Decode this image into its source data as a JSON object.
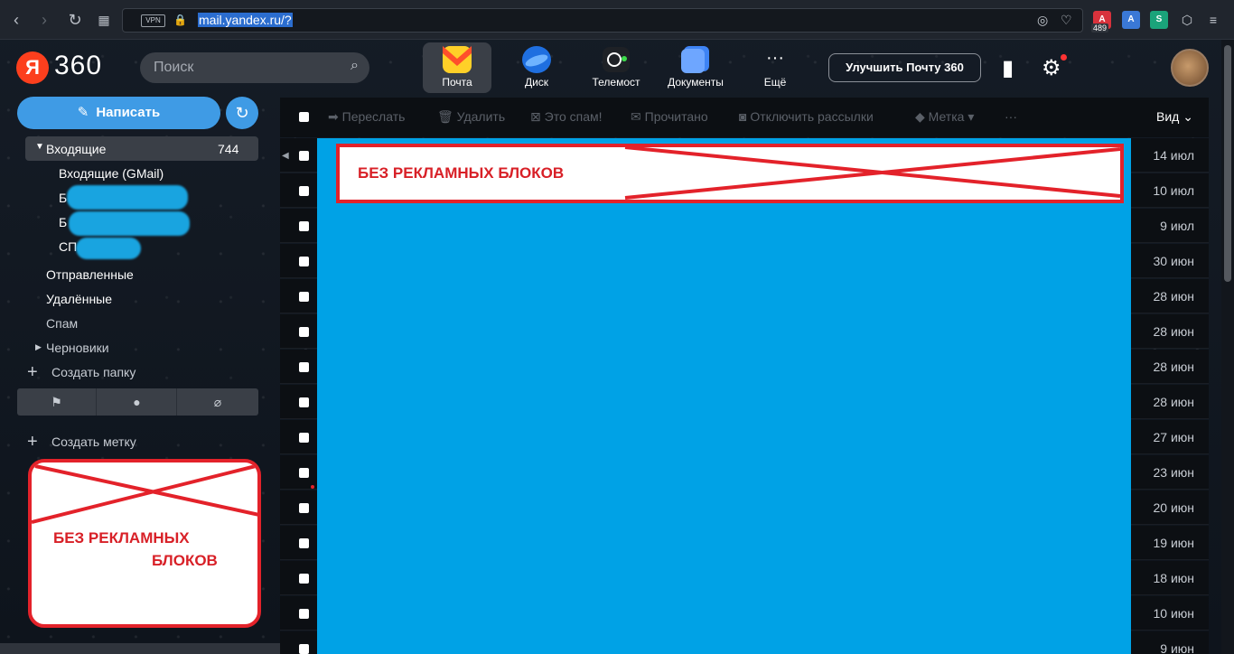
{
  "browser": {
    "url": "mail.yandex.ru/?",
    "vpn_label": "VPN",
    "ext_badge": "489"
  },
  "header": {
    "logo_ya": "Я",
    "logo_360": "360",
    "search_placeholder": "Поиск",
    "apps": [
      {
        "label": "Почта",
        "color": "#ffd028"
      },
      {
        "label": "Диск",
        "color": "#2b7de9"
      },
      {
        "label": "Телемост",
        "color": "#1e2126"
      },
      {
        "label": "Документы",
        "color": "#4d8df6"
      },
      {
        "label": "Ещё",
        "color": "transparent"
      }
    ],
    "upgrade_label": "Улучшить Почту 360"
  },
  "sidebar": {
    "compose_label": "Написать",
    "inbox_label": "Входящие",
    "inbox_count": "744",
    "folders": [
      {
        "label": "Входящие (GMail)"
      },
      {
        "label": "Б"
      },
      {
        "label": "Б"
      },
      {
        "label": "СП"
      }
    ],
    "sent": "Отправленные",
    "deleted": "Удалённые",
    "spam": "Спам",
    "drafts": "Черновики",
    "create_folder": "Создать папку",
    "create_label": "Создать метку",
    "ad_line1": "БЕЗ РЕКЛАМНЫХ",
    "ad_line2": "БЛОКОВ"
  },
  "toolbar": {
    "forward": "Переслать",
    "delete": "Удалить",
    "spam": "Это спам!",
    "read": "Прочитано",
    "unsubscribe": "Отключить рассылки",
    "label": "Метка",
    "more": "···",
    "view": "Вид"
  },
  "main": {
    "ad_text": "БЕЗ РЕКЛАМНЫХ БЛОКОВ",
    "dates": [
      "14 июл",
      "10 июл",
      "9 июл",
      "30 июн",
      "28 июн",
      "28 июн",
      "28 июн",
      "28 июн",
      "27 июн",
      "23 июн",
      "20 июн",
      "19 июн",
      "18 июн",
      "10 июн",
      "9 июн"
    ]
  },
  "colors": {
    "accent": "#3f9be5",
    "ad_red": "#e3222a",
    "panel_blue": "#00a2e6"
  }
}
